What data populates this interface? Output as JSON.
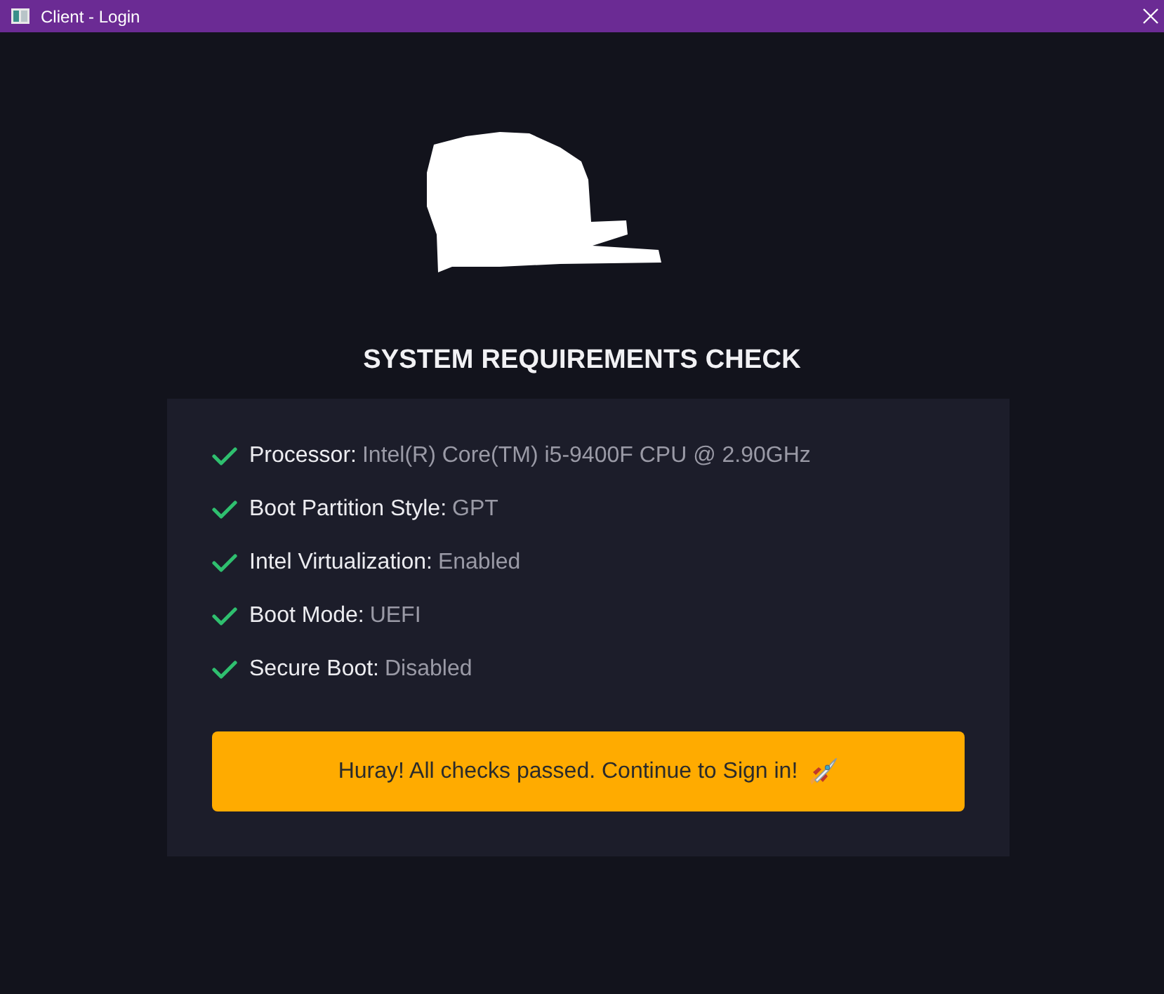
{
  "window": {
    "title": "Client - Login"
  },
  "heading": "SYSTEM REQUIREMENTS CHECK",
  "checks": [
    {
      "label": "Processor:",
      "value": "Intel(R) Core(TM) i5-9400F CPU @ 2.90GHz",
      "passed": true
    },
    {
      "label": "Boot Partition Style:",
      "value": "GPT",
      "passed": true
    },
    {
      "label": "Intel Virtualization:",
      "value": "Enabled",
      "passed": true
    },
    {
      "label": "Boot Mode:",
      "value": "UEFI",
      "passed": true
    },
    {
      "label": "Secure Boot:",
      "value": "Disabled",
      "passed": true
    }
  ],
  "button": {
    "label": "Huray! All checks passed. Continue to Sign in!"
  }
}
